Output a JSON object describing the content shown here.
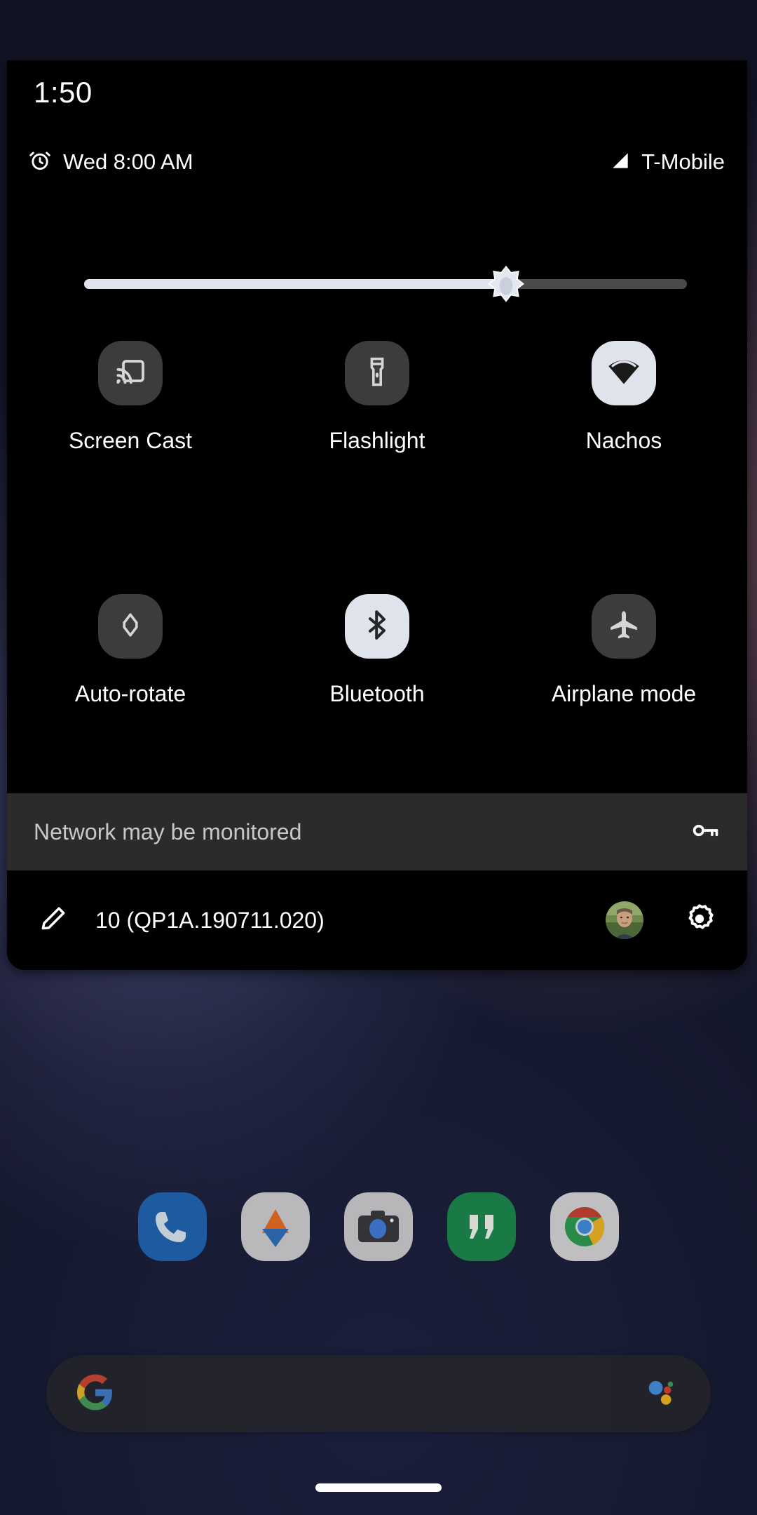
{
  "status_bar": {
    "time": "1:50"
  },
  "qs_header": {
    "alarm_icon": "alarm-clock-icon",
    "alarm_text": "Wed 8:00 AM",
    "signal_icon": "cell-signal-icon",
    "carrier": "T-Mobile"
  },
  "brightness": {
    "icon": "brightness-sun-icon",
    "value_percent": 70,
    "fill_color": "#dfe3ec",
    "track_color": "#4a4a4a"
  },
  "tiles": [
    {
      "label": "Screen Cast",
      "icon": "screen-cast-icon",
      "active": false
    },
    {
      "label": "Flashlight",
      "icon": "flashlight-icon",
      "active": false
    },
    {
      "label": "Nachos",
      "icon": "wifi-icon",
      "active": true
    },
    {
      "label": "Auto-rotate",
      "icon": "auto-rotate-icon",
      "active": false
    },
    {
      "label": "Bluetooth",
      "icon": "bluetooth-icon",
      "active": true
    },
    {
      "label": "Airplane mode",
      "icon": "airplane-icon",
      "active": false
    }
  ],
  "monitor_banner": {
    "text": "Network may be monitored",
    "icon": "vpn-key-icon"
  },
  "footer": {
    "edit_icon": "pencil-edit-icon",
    "build_text": "10 (QP1A.190711.020)",
    "avatar_icon": "user-avatar",
    "settings_icon": "gear-icon"
  },
  "dock": [
    {
      "name": "Phone",
      "icon": "phone-app-icon"
    },
    {
      "name": "Drive",
      "icon": "drive-app-icon"
    },
    {
      "name": "Camera",
      "icon": "camera-app-icon"
    },
    {
      "name": "Hangouts",
      "icon": "hangouts-app-icon"
    },
    {
      "name": "Chrome",
      "icon": "chrome-app-icon"
    }
  ],
  "search": {
    "logo_icon": "google-g-icon",
    "placeholder": "",
    "value": "",
    "assistant_icon": "google-assistant-icon"
  },
  "nav": {
    "pill": "gesture-nav-pill"
  },
  "colors": {
    "panel_bg": "#000000",
    "tile_off": "#3c3c3c",
    "tile_on": "#dfe3ec",
    "banner_bg": "#2b2b2b",
    "text_primary": "#ffffff",
    "text_secondary": "#c7c7c7"
  }
}
